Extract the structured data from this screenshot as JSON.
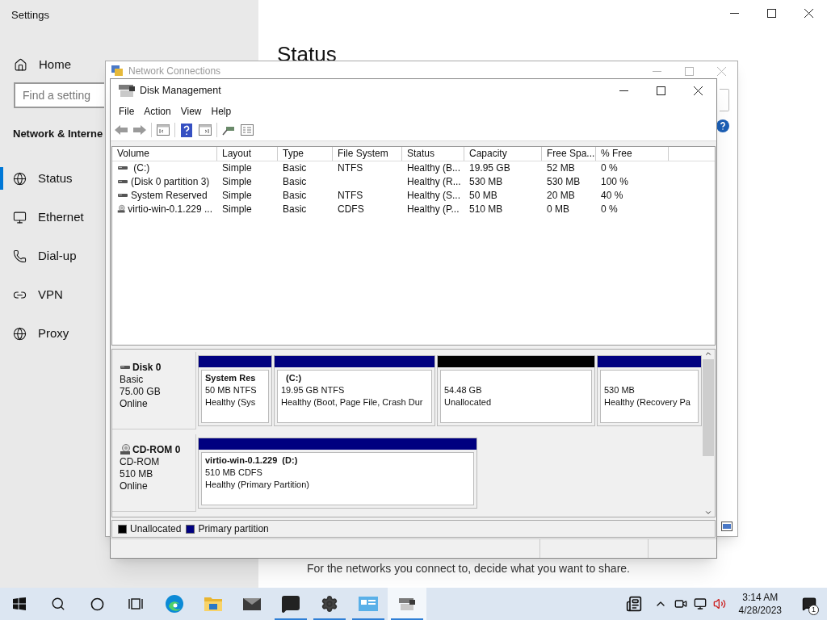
{
  "settings": {
    "title": "Settings",
    "search": {
      "placeholder": "Find a setting"
    },
    "section": "Network & Interne",
    "heading": "Status",
    "footer_text": "For the networks you connect to, decide what you want to share.",
    "nav": [
      {
        "label": "Home",
        "kind": "home",
        "selected": false
      },
      {
        "label": "Status",
        "kind": "status",
        "selected": true
      },
      {
        "label": "Ethernet",
        "kind": "ethernet",
        "selected": false
      },
      {
        "label": "Dial-up",
        "kind": "dialup",
        "selected": false
      },
      {
        "label": "VPN",
        "kind": "vpn",
        "selected": false
      },
      {
        "label": "Proxy",
        "kind": "proxy",
        "selected": false
      }
    ]
  },
  "network_window": {
    "title": "Network Connections"
  },
  "disk_window": {
    "title": "Disk Management",
    "menu": [
      "File",
      "Action",
      "View",
      "Help"
    ],
    "table": {
      "columns": [
        "Volume",
        "Layout",
        "Type",
        "File System",
        "Status",
        "Capacity",
        "Free Spa...",
        "% Free"
      ],
      "rows": [
        {
          "kind": "disk",
          "cells": [
            " (C:)",
            "Simple",
            "Basic",
            "NTFS",
            "Healthy (B...",
            "19.95 GB",
            "52 MB",
            "0 %"
          ]
        },
        {
          "kind": "disk",
          "cells": [
            "(Disk 0 partition 3)",
            "Simple",
            "Basic",
            "",
            "Healthy (R...",
            "530 MB",
            "530 MB",
            "100 %"
          ]
        },
        {
          "kind": "disk",
          "cells": [
            "System Reserved",
            "Simple",
            "Basic",
            "NTFS",
            "Healthy (S...",
            "50 MB",
            "20 MB",
            "40 %"
          ]
        },
        {
          "kind": "cd",
          "cells": [
            "virtio-win-0.1.229 ...",
            "Simple",
            "Basic",
            "CDFS",
            "Healthy (P...",
            "510 MB",
            "0 MB",
            "0 %"
          ]
        }
      ]
    },
    "disks": [
      {
        "kind": "disk",
        "name": "Disk 0",
        "lines": [
          "Basic",
          "75.00 GB",
          "Online"
        ],
        "partitions": [
          {
            "kind": "primary",
            "title": "System Res",
            "lines": [
              "50 MB NTFS",
              "Healthy (Sys"
            ]
          },
          {
            "kind": "primary",
            "title": "  (C:)",
            "lines": [
              "19.95 GB NTFS",
              "Healthy (Boot, Page File, Crash Dur"
            ]
          },
          {
            "kind": "unallocated",
            "lines": [
              "54.48 GB",
              "Unallocated"
            ]
          },
          {
            "kind": "primary",
            "lines": [
              "530 MB",
              "Healthy (Recovery Pa"
            ]
          }
        ]
      },
      {
        "kind": "cd",
        "name": "CD-ROM 0",
        "lines": [
          "CD-ROM",
          "510 MB",
          "Online"
        ],
        "partitions": [
          {
            "kind": "primary",
            "title": "virtio-win-0.1.229  (D:)",
            "lines": [
              "510 MB CDFS",
              "Healthy (Primary Partition)"
            ]
          }
        ]
      }
    ],
    "legend": [
      {
        "label": "Unallocated",
        "color": "#000000"
      },
      {
        "label": "Primary partition",
        "color": "#000080"
      }
    ]
  },
  "taskbar": {
    "apps": [
      {
        "kind": "start",
        "running": false,
        "selected": false
      },
      {
        "kind": "search",
        "running": false,
        "selected": false
      },
      {
        "kind": "cortana",
        "running": false,
        "selected": false
      },
      {
        "kind": "taskview",
        "running": false,
        "selected": false
      },
      {
        "kind": "edge",
        "running": false,
        "selected": false
      },
      {
        "kind": "explorer",
        "running": false,
        "selected": false
      },
      {
        "kind": "mail",
        "running": false,
        "selected": false
      },
      {
        "kind": "feedback",
        "running": true,
        "selected": false
      },
      {
        "kind": "settings",
        "running": true,
        "selected": false
      },
      {
        "kind": "controlpanel",
        "running": true,
        "selected": false
      },
      {
        "kind": "diskmgmt",
        "running": true,
        "selected": true
      }
    ],
    "time": "3:14 AM",
    "date": "4/28/2023",
    "notifications": "1"
  }
}
